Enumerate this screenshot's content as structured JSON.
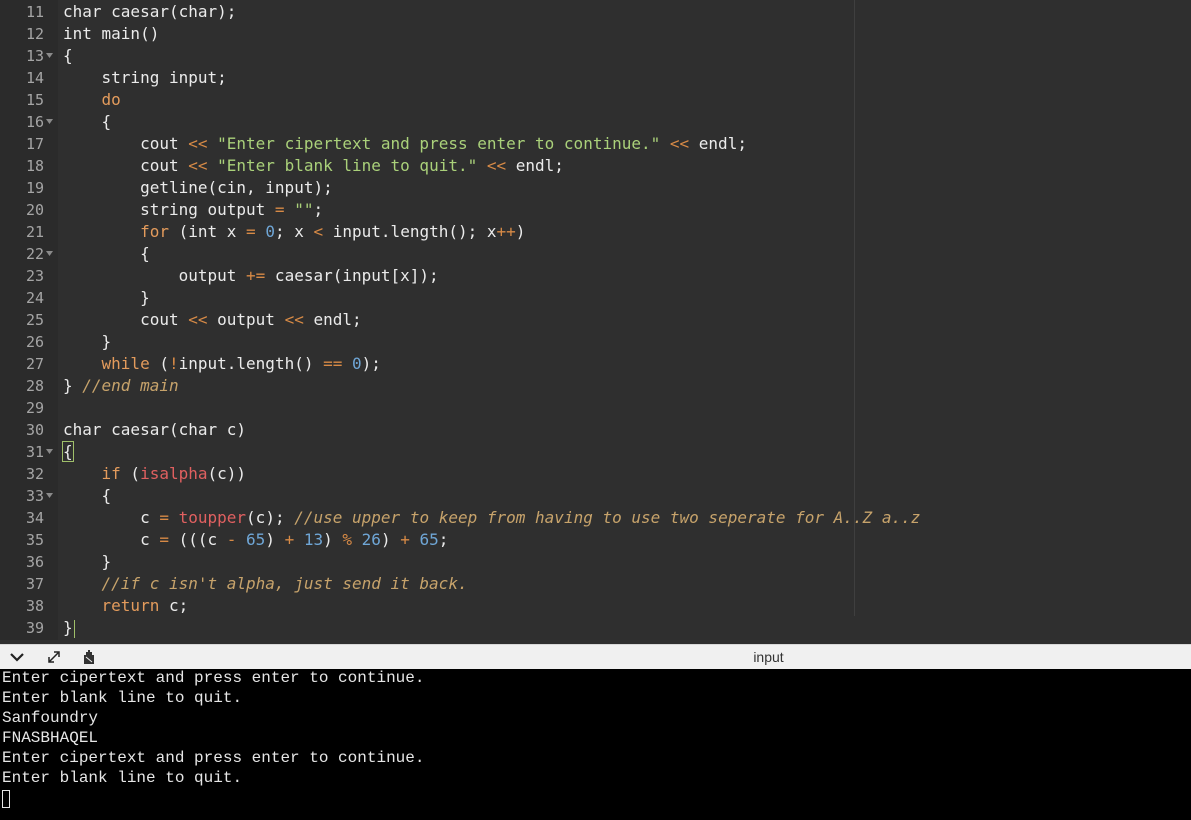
{
  "editor": {
    "lines": [
      {
        "n": "11",
        "fold": false,
        "tokens": [
          [
            "plain",
            "char caesar(char);"
          ]
        ]
      },
      {
        "n": "12",
        "fold": false,
        "tokens": [
          [
            "plain",
            "int main()"
          ]
        ]
      },
      {
        "n": "13",
        "fold": true,
        "tokens": [
          [
            "plain",
            "{"
          ]
        ]
      },
      {
        "n": "14",
        "fold": false,
        "tokens": [
          [
            "plain",
            "    string input;"
          ]
        ]
      },
      {
        "n": "15",
        "fold": false,
        "tokens": [
          [
            "plain",
            "    "
          ],
          [
            "kw",
            "do"
          ]
        ]
      },
      {
        "n": "16",
        "fold": true,
        "tokens": [
          [
            "plain",
            "    {"
          ]
        ]
      },
      {
        "n": "17",
        "fold": false,
        "tokens": [
          [
            "plain",
            "        cout "
          ],
          [
            "op",
            "<<"
          ],
          [
            "plain",
            " "
          ],
          [
            "str",
            "\"Enter cipertext and press enter to continue.\""
          ],
          [
            "plain",
            " "
          ],
          [
            "op",
            "<<"
          ],
          [
            "plain",
            " endl;"
          ]
        ]
      },
      {
        "n": "18",
        "fold": false,
        "tokens": [
          [
            "plain",
            "        cout "
          ],
          [
            "op",
            "<<"
          ],
          [
            "plain",
            " "
          ],
          [
            "str",
            "\"Enter blank line to quit.\""
          ],
          [
            "plain",
            " "
          ],
          [
            "op",
            "<<"
          ],
          [
            "plain",
            " endl;"
          ]
        ]
      },
      {
        "n": "19",
        "fold": false,
        "tokens": [
          [
            "plain",
            "        getline(cin, input);"
          ]
        ]
      },
      {
        "n": "20",
        "fold": false,
        "tokens": [
          [
            "plain",
            "        string output "
          ],
          [
            "op",
            "="
          ],
          [
            "plain",
            " "
          ],
          [
            "str",
            "\"\""
          ],
          [
            "plain",
            ";"
          ]
        ]
      },
      {
        "n": "21",
        "fold": false,
        "tokens": [
          [
            "plain",
            "        "
          ],
          [
            "kw",
            "for"
          ],
          [
            "plain",
            " (int x "
          ],
          [
            "op",
            "="
          ],
          [
            "plain",
            " "
          ],
          [
            "num",
            "0"
          ],
          [
            "plain",
            "; x "
          ],
          [
            "op",
            "<"
          ],
          [
            "plain",
            " input.length(); x"
          ],
          [
            "op",
            "++"
          ],
          [
            "plain",
            ")"
          ]
        ]
      },
      {
        "n": "22",
        "fold": true,
        "tokens": [
          [
            "plain",
            "        {"
          ]
        ]
      },
      {
        "n": "23",
        "fold": false,
        "tokens": [
          [
            "plain",
            "            output "
          ],
          [
            "op",
            "+="
          ],
          [
            "plain",
            " caesar(input[x]);"
          ]
        ]
      },
      {
        "n": "24",
        "fold": false,
        "tokens": [
          [
            "plain",
            "        }"
          ]
        ]
      },
      {
        "n": "25",
        "fold": false,
        "tokens": [
          [
            "plain",
            "        cout "
          ],
          [
            "op",
            "<<"
          ],
          [
            "plain",
            " output "
          ],
          [
            "op",
            "<<"
          ],
          [
            "plain",
            " endl;"
          ]
        ]
      },
      {
        "n": "26",
        "fold": false,
        "tokens": [
          [
            "plain",
            "    }"
          ]
        ]
      },
      {
        "n": "27",
        "fold": false,
        "tokens": [
          [
            "plain",
            "    "
          ],
          [
            "kw",
            "while"
          ],
          [
            "plain",
            " ("
          ],
          [
            "op",
            "!"
          ],
          [
            "plain",
            "input.length() "
          ],
          [
            "op",
            "=="
          ],
          [
            "plain",
            " "
          ],
          [
            "num",
            "0"
          ],
          [
            "plain",
            ");"
          ]
        ]
      },
      {
        "n": "28",
        "fold": false,
        "tokens": [
          [
            "plain",
            "} "
          ],
          [
            "cmt",
            "//end main"
          ]
        ]
      },
      {
        "n": "29",
        "fold": false,
        "tokens": [
          [
            "plain",
            ""
          ]
        ]
      },
      {
        "n": "30",
        "fold": false,
        "tokens": [
          [
            "plain",
            "char caesar(char c)"
          ]
        ]
      },
      {
        "n": "31",
        "fold": true,
        "tokens": [
          [
            "bracket",
            "{"
          ]
        ]
      },
      {
        "n": "32",
        "fold": false,
        "tokens": [
          [
            "plain",
            "    "
          ],
          [
            "kw",
            "if"
          ],
          [
            "plain",
            " ("
          ],
          [
            "fn",
            "isalpha"
          ],
          [
            "plain",
            "(c))"
          ]
        ]
      },
      {
        "n": "33",
        "fold": true,
        "tokens": [
          [
            "plain",
            "    {"
          ]
        ]
      },
      {
        "n": "34",
        "fold": false,
        "tokens": [
          [
            "plain",
            "        c "
          ],
          [
            "op",
            "="
          ],
          [
            "plain",
            " "
          ],
          [
            "fn",
            "toupper"
          ],
          [
            "plain",
            "(c); "
          ],
          [
            "cmt",
            "//use upper to keep from having to use two seperate for A..Z a..z"
          ]
        ]
      },
      {
        "n": "35",
        "fold": false,
        "tokens": [
          [
            "plain",
            "        c "
          ],
          [
            "op",
            "="
          ],
          [
            "plain",
            " (((c "
          ],
          [
            "op",
            "-"
          ],
          [
            "plain",
            " "
          ],
          [
            "num",
            "65"
          ],
          [
            "plain",
            ") "
          ],
          [
            "op",
            "+"
          ],
          [
            "plain",
            " "
          ],
          [
            "num",
            "13"
          ],
          [
            "plain",
            ") "
          ],
          [
            "op",
            "%"
          ],
          [
            "plain",
            " "
          ],
          [
            "num",
            "26"
          ],
          [
            "plain",
            ") "
          ],
          [
            "op",
            "+"
          ],
          [
            "plain",
            " "
          ],
          [
            "num",
            "65"
          ],
          [
            "plain",
            ";"
          ]
        ]
      },
      {
        "n": "36",
        "fold": false,
        "tokens": [
          [
            "plain",
            "    }"
          ]
        ]
      },
      {
        "n": "37",
        "fold": false,
        "tokens": [
          [
            "plain",
            "    "
          ],
          [
            "cmt",
            "//if c isn't alpha, just send it back."
          ]
        ]
      },
      {
        "n": "38",
        "fold": false,
        "tokens": [
          [
            "plain",
            "    "
          ],
          [
            "kw",
            "return"
          ],
          [
            "plain",
            " c;"
          ]
        ]
      },
      {
        "n": "39",
        "fold": false,
        "tokens": [
          [
            "plain",
            "}"
          ],
          [
            "cursor",
            ""
          ]
        ]
      }
    ]
  },
  "panel": {
    "title": "input",
    "icons": [
      "chevron-down-icon",
      "expand-icon",
      "clear-console-icon"
    ]
  },
  "console": {
    "lines": [
      "Enter cipertext and press enter to continue.",
      "Enter blank line to quit.",
      "Sanfoundry",
      "FNASBHAQEL",
      "Enter cipertext and press enter to continue.",
      "Enter blank line to quit."
    ]
  },
  "colors": {
    "editor_bg": "#2f2f2f",
    "keyword": "#e39b5c",
    "string": "#aad17a",
    "number": "#6fa6d6",
    "function": "#e06060",
    "comment": "#c7a36b",
    "console_bg": "#000000"
  }
}
